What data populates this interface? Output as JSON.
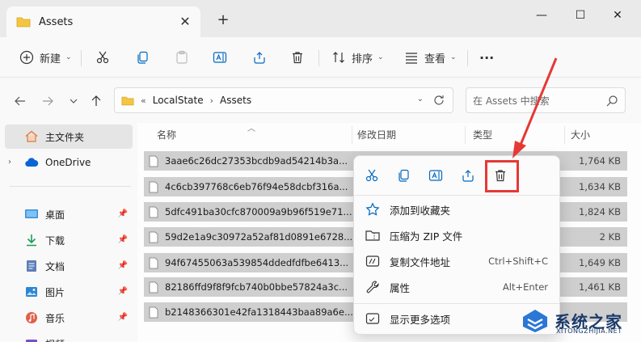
{
  "tab": {
    "title": "Assets",
    "close": "✕",
    "add": "+"
  },
  "window": {
    "minimize": "—",
    "maximize": "☐",
    "close": "✕"
  },
  "toolbar": {
    "new_label": "新建",
    "sort_label": "排序",
    "view_label": "查看",
    "more_label": "···"
  },
  "address": {
    "overflow": "«",
    "crumbs": [
      "LocalState",
      "Assets"
    ],
    "sep": "›"
  },
  "search": {
    "placeholder": "在 Assets 中搜索"
  },
  "sidebar": {
    "home": "主文件夹",
    "onedrive": "OneDrive",
    "items": [
      {
        "label": "桌面"
      },
      {
        "label": "下载"
      },
      {
        "label": "文档"
      },
      {
        "label": "图片"
      },
      {
        "label": "音乐"
      },
      {
        "label": "视频"
      }
    ]
  },
  "columns": {
    "name": "名称",
    "date": "修改日期",
    "type": "类型",
    "size": "大小"
  },
  "files": [
    {
      "name": "3aae6c26dc27353bcdb9ad54214b3a...",
      "size": "1,764 KB"
    },
    {
      "name": "4c6cb397768c6eb76f94e58dcbf316a...",
      "size": "1,634 KB"
    },
    {
      "name": "5dfc491ba30cfc870009a9b96f519e71...",
      "size": "1,824 KB"
    },
    {
      "name": "59d2e1a9c30972a52af81d0891e6728...",
      "size": "2 KB"
    },
    {
      "name": "94f67455063a539854ddedfdfbe6413...",
      "size": "1,649 KB"
    },
    {
      "name": "82186ffd9f8f9fcb740b0bbe57824a3c...",
      "size": "1,461 KB"
    },
    {
      "name": "b2148366301e42fa1318443baa89a6e...",
      "size": ""
    }
  ],
  "context_menu": {
    "items": [
      {
        "label": "添加到收藏夹",
        "shortcut": ""
      },
      {
        "label": "压缩为 ZIP 文件",
        "shortcut": ""
      },
      {
        "label": "复制文件地址",
        "shortcut": "Ctrl+Shift+C"
      },
      {
        "label": "属性",
        "shortcut": "Alt+Enter"
      },
      {
        "label": "显示更多选项",
        "shortcut": ""
      }
    ]
  },
  "watermark": {
    "text": "系统之家",
    "sub": "XITONGZHIJIA.NET"
  },
  "colors": {
    "highlight": "#e53935",
    "folder": "#f4c542",
    "accent": "#0067c0"
  }
}
